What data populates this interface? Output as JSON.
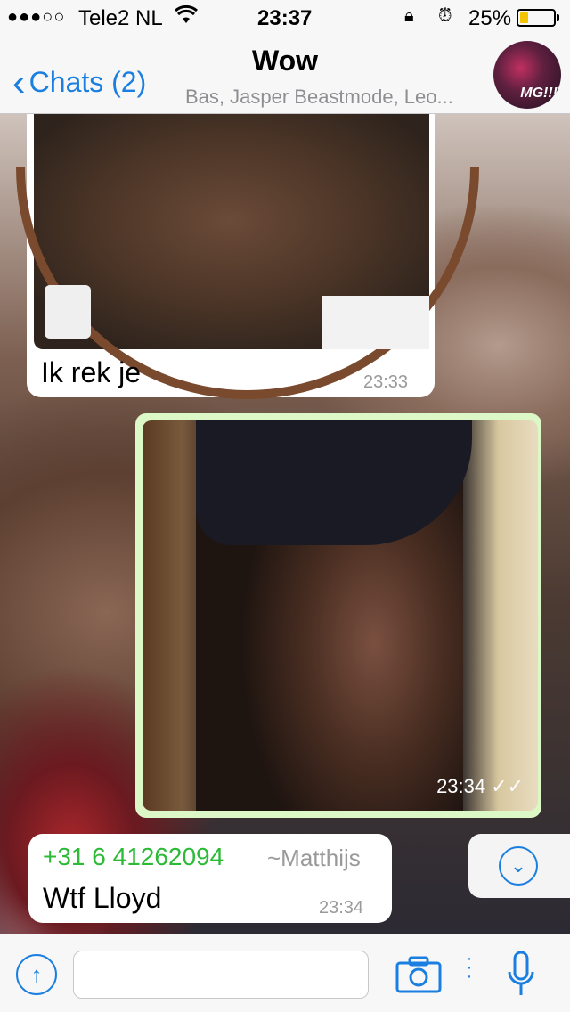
{
  "status_bar": {
    "signal": "●●●○○",
    "carrier": "Tele2 NL",
    "time": "23:37",
    "battery_pct": "25%",
    "battery_level": 0.25
  },
  "nav": {
    "back_label": "Chats (2)",
    "title": "Wow",
    "subtitle": "Bas, Jasper Beastmode, Leo...",
    "avatar_text": "MG!!!"
  },
  "messages": [
    {
      "direction": "incoming",
      "type": "photo",
      "caption": "Ik rek je",
      "time": "23:33"
    },
    {
      "direction": "outgoing",
      "type": "photo",
      "time": "23:34",
      "status": "read"
    },
    {
      "direction": "incoming",
      "type": "text",
      "sender_number": "+31 6 41262094",
      "sender_name": "~Matthijs",
      "text": "Wtf Lloyd",
      "time": "23:34"
    }
  ],
  "input": {
    "placeholder": ""
  },
  "colors": {
    "accent": "#1a7fe0",
    "outgoing_bubble": "#dcf8c6",
    "sender": "#2dba37"
  }
}
